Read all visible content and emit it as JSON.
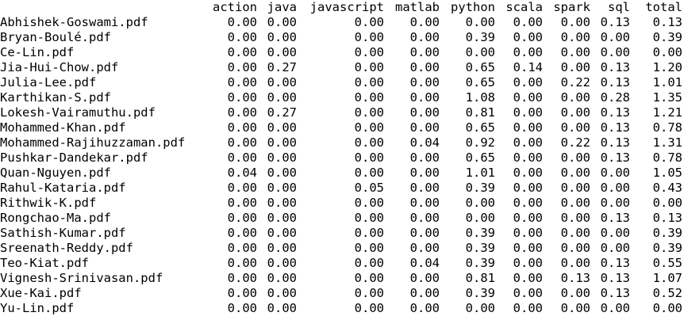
{
  "table": {
    "columns": [
      "action",
      "java",
      "javascript",
      "matlab",
      "python",
      "scala",
      "spark",
      "sql",
      "total"
    ],
    "rows": [
      {
        "name": "Abhishek-Goswami.pdf",
        "values": [
          "0.00",
          "0.00",
          "0.00",
          "0.00",
          "0.00",
          "0.00",
          "0.00",
          "0.13",
          "0.13"
        ]
      },
      {
        "name": "Bryan-Boulé.pdf",
        "values": [
          "0.00",
          "0.00",
          "0.00",
          "0.00",
          "0.39",
          "0.00",
          "0.00",
          "0.00",
          "0.39"
        ]
      },
      {
        "name": "Ce-Lin.pdf",
        "values": [
          "0.00",
          "0.00",
          "0.00",
          "0.00",
          "0.00",
          "0.00",
          "0.00",
          "0.00",
          "0.00"
        ]
      },
      {
        "name": "Jia-Hui-Chow.pdf",
        "values": [
          "0.00",
          "0.27",
          "0.00",
          "0.00",
          "0.65",
          "0.14",
          "0.00",
          "0.13",
          "1.20"
        ]
      },
      {
        "name": "Julia-Lee.pdf",
        "values": [
          "0.00",
          "0.00",
          "0.00",
          "0.00",
          "0.65",
          "0.00",
          "0.22",
          "0.13",
          "1.01"
        ]
      },
      {
        "name": "Karthikan-S.pdf",
        "values": [
          "0.00",
          "0.00",
          "0.00",
          "0.00",
          "1.08",
          "0.00",
          "0.00",
          "0.28",
          "1.35"
        ]
      },
      {
        "name": "Lokesh-Vairamuthu.pdf",
        "values": [
          "0.00",
          "0.27",
          "0.00",
          "0.00",
          "0.81",
          "0.00",
          "0.00",
          "0.13",
          "1.21"
        ]
      },
      {
        "name": "Mohammed-Khan.pdf",
        "values": [
          "0.00",
          "0.00",
          "0.00",
          "0.00",
          "0.65",
          "0.00",
          "0.00",
          "0.13",
          "0.78"
        ]
      },
      {
        "name": "Mohammed-Rajihuzzaman.pdf",
        "values": [
          "0.00",
          "0.00",
          "0.00",
          "0.04",
          "0.92",
          "0.00",
          "0.22",
          "0.13",
          "1.31"
        ]
      },
      {
        "name": "Pushkar-Dandekar.pdf",
        "values": [
          "0.00",
          "0.00",
          "0.00",
          "0.00",
          "0.65",
          "0.00",
          "0.00",
          "0.13",
          "0.78"
        ]
      },
      {
        "name": "Quan-Nguyen.pdf",
        "values": [
          "0.04",
          "0.00",
          "0.00",
          "0.00",
          "1.01",
          "0.00",
          "0.00",
          "0.00",
          "1.05"
        ]
      },
      {
        "name": "Rahul-Kataria.pdf",
        "values": [
          "0.00",
          "0.00",
          "0.05",
          "0.00",
          "0.39",
          "0.00",
          "0.00",
          "0.00",
          "0.43"
        ]
      },
      {
        "name": "Rithwik-K.pdf",
        "values": [
          "0.00",
          "0.00",
          "0.00",
          "0.00",
          "0.00",
          "0.00",
          "0.00",
          "0.00",
          "0.00"
        ]
      },
      {
        "name": "Rongchao-Ma.pdf",
        "values": [
          "0.00",
          "0.00",
          "0.00",
          "0.00",
          "0.00",
          "0.00",
          "0.00",
          "0.13",
          "0.13"
        ]
      },
      {
        "name": "Sathish-Kumar.pdf",
        "values": [
          "0.00",
          "0.00",
          "0.00",
          "0.00",
          "0.39",
          "0.00",
          "0.00",
          "0.00",
          "0.39"
        ]
      },
      {
        "name": "Sreenath-Reddy.pdf",
        "values": [
          "0.00",
          "0.00",
          "0.00",
          "0.00",
          "0.39",
          "0.00",
          "0.00",
          "0.00",
          "0.39"
        ]
      },
      {
        "name": "Teo-Kiat.pdf",
        "values": [
          "0.00",
          "0.00",
          "0.00",
          "0.04",
          "0.39",
          "0.00",
          "0.00",
          "0.13",
          "0.55"
        ]
      },
      {
        "name": "Vignesh-Srinivasan.pdf",
        "values": [
          "0.00",
          "0.00",
          "0.00",
          "0.00",
          "0.81",
          "0.00",
          "0.13",
          "0.13",
          "1.07"
        ]
      },
      {
        "name": "Xue-Kai.pdf",
        "values": [
          "0.00",
          "0.00",
          "0.00",
          "0.00",
          "0.39",
          "0.00",
          "0.00",
          "0.13",
          "0.52"
        ]
      },
      {
        "name": "Yu-Lin.pdf",
        "values": [
          "0.00",
          "0.00",
          "0.00",
          "0.00",
          "0.00",
          "0.00",
          "0.00",
          "0.00",
          "0.00"
        ]
      }
    ]
  }
}
